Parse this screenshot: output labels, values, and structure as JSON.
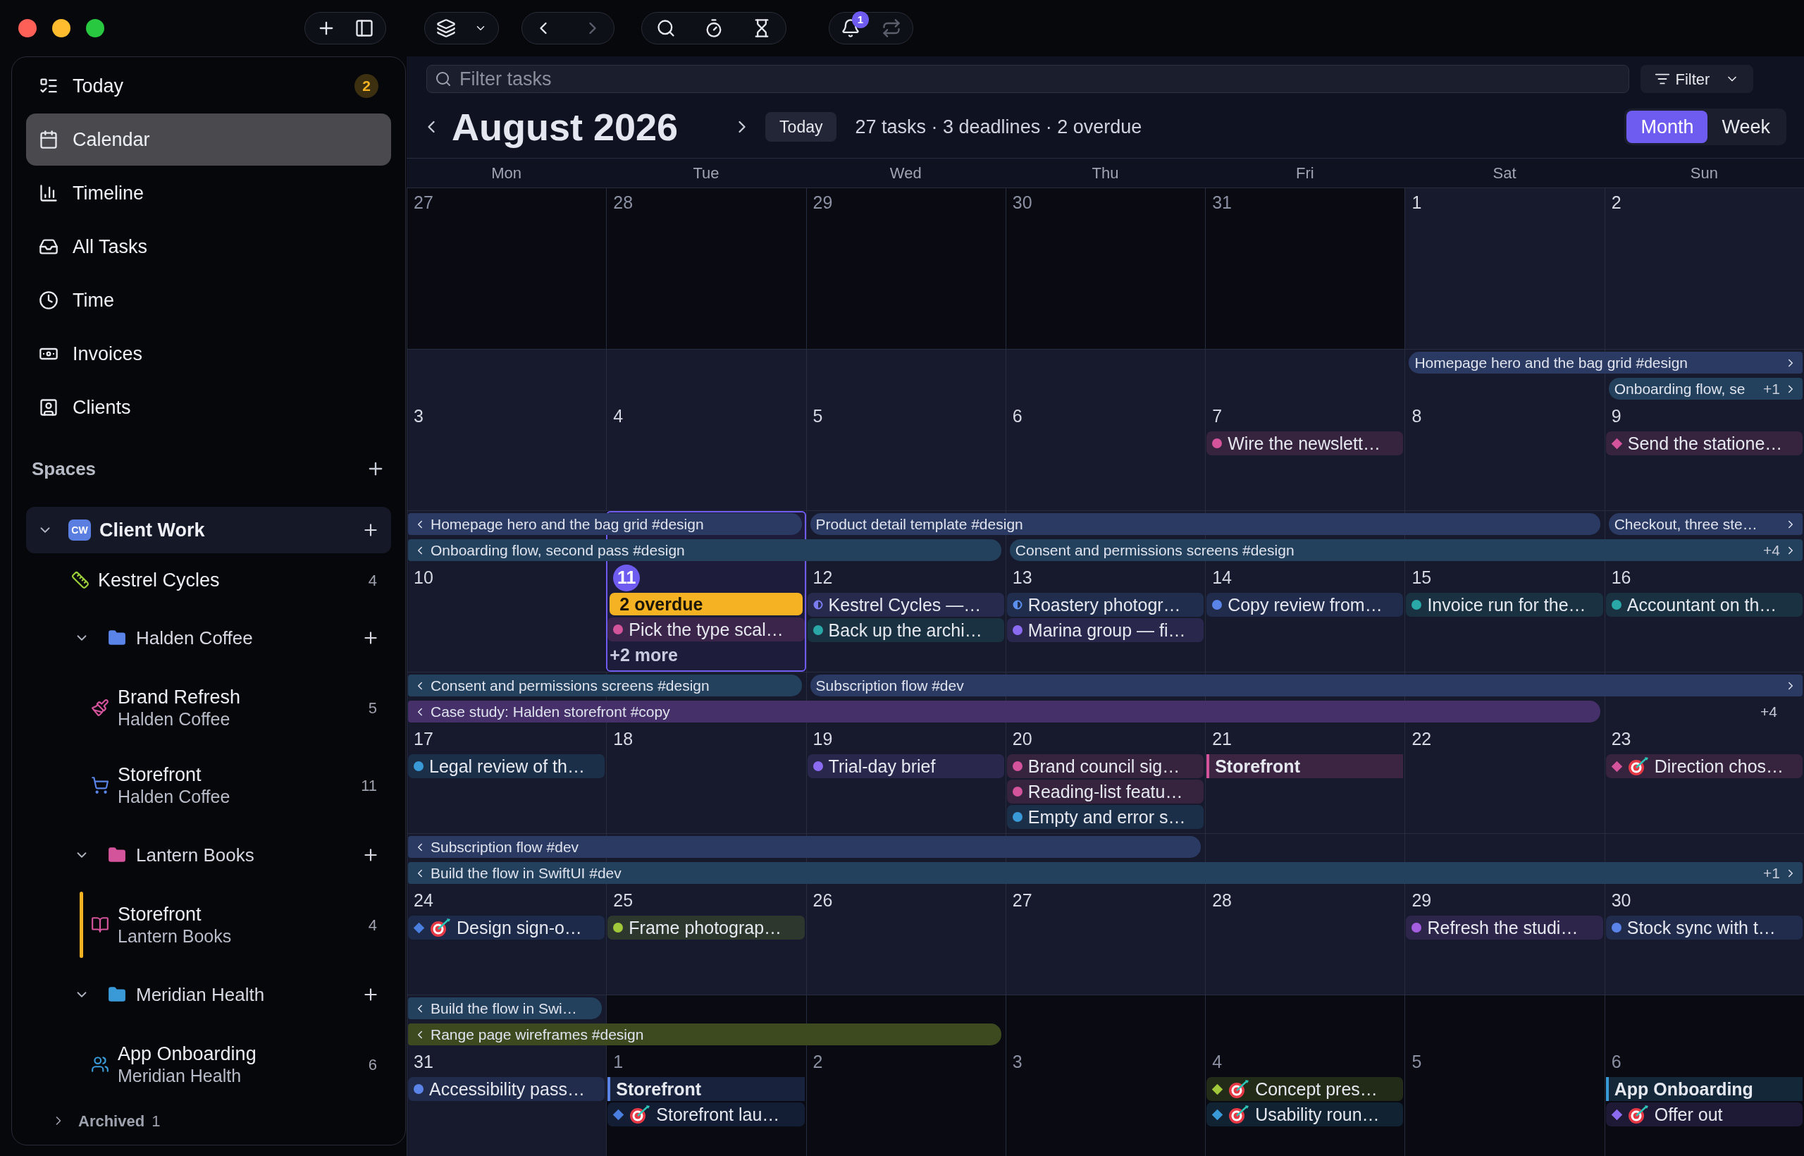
{
  "toolbar": {
    "notification_badge": "1",
    "forward_disabled": true,
    "sync_disabled": true
  },
  "sidebar": {
    "nav": [
      {
        "label": "Today",
        "badge": "2",
        "selected": false
      },
      {
        "label": "Calendar",
        "selected": true
      },
      {
        "label": "Timeline",
        "selected": false
      },
      {
        "label": "All Tasks",
        "selected": false
      },
      {
        "label": "Time",
        "selected": false
      },
      {
        "label": "Invoices",
        "selected": false
      },
      {
        "label": "Clients",
        "selected": false
      }
    ],
    "spaces_title": "Spaces",
    "spaces": [
      {
        "label": "Client Work",
        "initials": "CW",
        "expanded": true,
        "children": [
          {
            "kind": "project",
            "label": "Kestrel Cycles",
            "count": "4",
            "color": "#9ccf3a",
            "marked": false
          },
          {
            "kind": "folder",
            "label": "Halden Coffee",
            "color": "#5b84e8",
            "expanded": true,
            "children": [
              {
                "kind": "project",
                "label": "Brand Refresh",
                "subtitle": "Halden Coffee",
                "count": "5",
                "color": "#d4549c",
                "marked": false
              },
              {
                "kind": "project",
                "label": "Storefront",
                "subtitle": "Halden Coffee",
                "count": "11",
                "color": "#5b84e8",
                "marked": false
              }
            ]
          },
          {
            "kind": "folder",
            "label": "Lantern Books",
            "color": "#d4549c",
            "expanded": true,
            "children": [
              {
                "kind": "project",
                "label": "Storefront",
                "subtitle": "Lantern Books",
                "count": "4",
                "color": "#d4549c",
                "marked": true
              }
            ]
          },
          {
            "kind": "folder",
            "label": "Meridian Health",
            "color": "#3a9ad8",
            "expanded": true,
            "children": [
              {
                "kind": "project",
                "label": "App Onboarding",
                "subtitle": "Meridian Health",
                "count": "6",
                "color": "#3a9ad8",
                "marked": false
              }
            ]
          }
        ]
      }
    ],
    "archived": {
      "label": "Archived",
      "count": "1",
      "expanded": false
    }
  },
  "filter": {
    "placeholder": "Filter tasks",
    "button": "Filter"
  },
  "header": {
    "title": "August 2026",
    "today_button": "Today",
    "summary": "27 tasks · 3 deadlines · 2 overdue",
    "view_modes": [
      {
        "label": "Month",
        "selected": true
      },
      {
        "label": "Week",
        "selected": false
      }
    ]
  },
  "calendar": {
    "weekdays": [
      "Mon",
      "Tue",
      "Wed",
      "Thu",
      "Fri",
      "Sat",
      "Sun"
    ],
    "weeks": [
      {
        "days": [
          {
            "number": "27",
            "muted": true,
            "today": false
          },
          {
            "number": "28",
            "muted": true,
            "today": false
          },
          {
            "number": "29",
            "muted": true,
            "today": false
          },
          {
            "number": "30",
            "muted": true,
            "today": false
          },
          {
            "number": "31",
            "muted": true,
            "today": false
          },
          {
            "number": "1",
            "muted": false,
            "today": false
          },
          {
            "number": "2",
            "muted": false,
            "today": false
          }
        ]
      },
      {
        "lanes": [
          [
            {
              "kind": "empty"
            },
            {
              "kind": "empty"
            },
            {
              "kind": "empty"
            },
            {
              "kind": "empty"
            },
            {
              "kind": "empty"
            },
            {
              "kind": "bar",
              "label": "Homepage hero and the bag grid #design",
              "continues_left": false,
              "continues_right": true,
              "color": "#2b3a63"
            },
            {
              "kind": "span"
            }
          ],
          [
            {
              "kind": "empty"
            },
            {
              "kind": "empty"
            },
            {
              "kind": "empty"
            },
            {
              "kind": "empty"
            },
            {
              "kind": "empty"
            },
            {
              "kind": "empty"
            },
            {
              "kind": "bar",
              "label": "Onboarding flow, se",
              "continues_left": false,
              "continues_right": true,
              "more": "+1",
              "color": "#23405c"
            }
          ]
        ],
        "days": [
          {
            "number": "3",
            "muted": false,
            "today": false
          },
          {
            "number": "4",
            "muted": false,
            "today": false
          },
          {
            "number": "5",
            "muted": false,
            "today": false
          },
          {
            "number": "6",
            "muted": false,
            "today": false
          },
          {
            "number": "7",
            "muted": false,
            "today": false,
            "items": [
              {
                "kind": "task",
                "label": "Wire the newslett…",
                "color": "#d4549c"
              }
            ]
          },
          {
            "number": "8",
            "muted": false,
            "today": false
          },
          {
            "number": "9",
            "muted": false,
            "today": false,
            "items": [
              {
                "kind": "deadline",
                "label": "Send the statione…",
                "color": "#d4549c",
                "target": false
              }
            ]
          }
        ]
      },
      {
        "lanes": [
          [
            {
              "kind": "bar",
              "label": "Homepage hero and the bag grid #design",
              "continues_left": true,
              "continues_right": false,
              "color": "#2b3a63"
            },
            {
              "kind": "span"
            },
            {
              "kind": "bar",
              "label": "Product detail template #design",
              "continues_left": false,
              "continues_right": false,
              "color": "#2b3a63"
            },
            {
              "kind": "span"
            },
            {
              "kind": "span"
            },
            {
              "kind": "span"
            },
            {
              "kind": "bar",
              "label": "Checkout, three ste…",
              "continues_left": false,
              "continues_right": true,
              "color": "#2b3a63"
            }
          ],
          [
            {
              "kind": "bar",
              "label": "Onboarding flow, second pass #design",
              "continues_left": true,
              "continues_right": false,
              "color": "#23405c"
            },
            {
              "kind": "span"
            },
            {
              "kind": "span"
            },
            {
              "kind": "bar",
              "label": "Consent and permissions screens #design",
              "continues_left": false,
              "continues_right": true,
              "more": "+4",
              "color": "#23405c"
            },
            {
              "kind": "span"
            },
            {
              "kind": "span"
            },
            {
              "kind": "span"
            }
          ]
        ],
        "days": [
          {
            "number": "10",
            "muted": false,
            "today": false
          },
          {
            "number": "11",
            "muted": false,
            "today": true,
            "items": [
              {
                "kind": "overdue",
                "label": "2 overdue"
              },
              {
                "kind": "task",
                "label": "Pick the type scal…",
                "color": "#d4549c"
              },
              {
                "kind": "more",
                "label": "+2 more"
              }
            ]
          },
          {
            "number": "12",
            "muted": false,
            "today": false,
            "items": [
              {
                "kind": "progress",
                "label": "Kestrel Cycles —…",
                "color": "#7a7cf0"
              },
              {
                "kind": "task",
                "label": "Back up the archi…",
                "color": "#2aa8a8"
              }
            ]
          },
          {
            "number": "13",
            "muted": false,
            "today": false,
            "items": [
              {
                "kind": "progress",
                "label": "Roastery photogr…",
                "color": "#5b8ff0"
              },
              {
                "kind": "task",
                "label": "Marina group — fi…",
                "color": "#8b6cf0"
              }
            ]
          },
          {
            "number": "14",
            "muted": false,
            "today": false,
            "items": [
              {
                "kind": "task",
                "label": "Copy review from…",
                "color": "#5b84e8"
              }
            ]
          },
          {
            "number": "15",
            "muted": false,
            "today": false,
            "items": [
              {
                "kind": "task",
                "label": "Invoice run for the…",
                "color": "#2aa8a8"
              }
            ]
          },
          {
            "number": "16",
            "muted": false,
            "today": false,
            "items": [
              {
                "kind": "task",
                "label": "Accountant on th…",
                "color": "#2aa8a8"
              }
            ]
          }
        ]
      },
      {
        "lanes": [
          [
            {
              "kind": "bar",
              "label": "Consent and permissions screens #design",
              "continues_left": true,
              "continues_right": false,
              "color": "#23405c"
            },
            {
              "kind": "span"
            },
            {
              "kind": "bar",
              "label": "Subscription flow #dev",
              "continues_left": false,
              "continues_right": true,
              "color": "#2b3a63"
            },
            {
              "kind": "span"
            },
            {
              "kind": "span"
            },
            {
              "kind": "span"
            },
            {
              "kind": "span"
            }
          ],
          [
            {
              "kind": "bar",
              "label": "Case study: Halden storefront #copy",
              "continues_left": true,
              "continues_right": false,
              "color": "#45306a"
            },
            {
              "kind": "span"
            },
            {
              "kind": "span"
            },
            {
              "kind": "span"
            },
            {
              "kind": "span"
            },
            {
              "kind": "span"
            },
            {
              "kind": "more",
              "label": "+4"
            }
          ]
        ],
        "days": [
          {
            "number": "17",
            "muted": false,
            "today": false,
            "items": [
              {
                "kind": "task",
                "label": "Legal review of th…",
                "color": "#3a9ad8"
              }
            ]
          },
          {
            "number": "18",
            "muted": false,
            "today": false
          },
          {
            "number": "19",
            "muted": false,
            "today": false,
            "items": [
              {
                "kind": "task",
                "label": "Trial-day brief",
                "color": "#8b6cf0"
              }
            ]
          },
          {
            "number": "20",
            "muted": false,
            "today": false,
            "items": [
              {
                "kind": "task",
                "label": "Brand council sig…",
                "color": "#d4549c"
              },
              {
                "kind": "task",
                "label": "Reading-list featu…",
                "color": "#d4549c"
              },
              {
                "kind": "task",
                "label": "Empty and error s…",
                "color": "#3a9ad8"
              }
            ]
          },
          {
            "number": "21",
            "muted": false,
            "today": false,
            "items": [
              {
                "kind": "project",
                "label": "Storefront",
                "color": "#d4549c"
              }
            ]
          },
          {
            "number": "22",
            "muted": false,
            "today": false
          },
          {
            "number": "23",
            "muted": false,
            "today": false,
            "items": [
              {
                "kind": "deadline",
                "label": "Direction chos…",
                "color": "#d4549c",
                "target": true
              }
            ]
          }
        ]
      },
      {
        "lanes": [
          [
            {
              "kind": "bar",
              "label": "Subscription flow #dev",
              "continues_left": true,
              "continues_right": false,
              "color": "#2b3a63"
            },
            {
              "kind": "span"
            },
            {
              "kind": "span"
            },
            {
              "kind": "span"
            },
            {
              "kind": "empty"
            },
            {
              "kind": "empty"
            },
            {
              "kind": "empty"
            }
          ],
          [
            {
              "kind": "bar",
              "label": "Build the flow in SwiftUI #dev",
              "continues_left": true,
              "continues_right": true,
              "more": "+1",
              "color": "#23405c"
            },
            {
              "kind": "span"
            },
            {
              "kind": "span"
            },
            {
              "kind": "span"
            },
            {
              "kind": "span"
            },
            {
              "kind": "span"
            },
            {
              "kind": "span"
            }
          ]
        ],
        "days": [
          {
            "number": "24",
            "muted": false,
            "today": false,
            "items": [
              {
                "kind": "deadline",
                "label": "Design sign-o…",
                "color": "#4a7fe0",
                "target": true
              }
            ]
          },
          {
            "number": "25",
            "muted": false,
            "today": false,
            "items": [
              {
                "kind": "task",
                "label": "Frame photograp…",
                "color": "#a0c83a"
              }
            ]
          },
          {
            "number": "26",
            "muted": false,
            "today": false
          },
          {
            "number": "27",
            "muted": false,
            "today": false
          },
          {
            "number": "28",
            "muted": false,
            "today": false
          },
          {
            "number": "29",
            "muted": false,
            "today": false,
            "items": [
              {
                "kind": "task",
                "label": "Refresh the studi…",
                "color": "#a65ee0"
              }
            ]
          },
          {
            "number": "30",
            "muted": false,
            "today": false,
            "items": [
              {
                "kind": "task",
                "label": "Stock sync with t…",
                "color": "#5b84e8"
              }
            ]
          }
        ]
      },
      {
        "lanes": [
          [
            {
              "kind": "bar",
              "label": "Build the flow in Swi…",
              "continues_left": true,
              "continues_right": false,
              "color": "#23405c"
            },
            {
              "kind": "empty"
            },
            {
              "kind": "empty"
            },
            {
              "kind": "empty"
            },
            {
              "kind": "empty"
            },
            {
              "kind": "empty"
            },
            {
              "kind": "empty"
            }
          ],
          [
            {
              "kind": "bar",
              "label": "Range page wireframes #design",
              "continues_left": true,
              "continues_right": false,
              "color": "#3d4a1f"
            },
            {
              "kind": "span"
            },
            {
              "kind": "span"
            },
            {
              "kind": "empty"
            },
            {
              "kind": "empty"
            },
            {
              "kind": "empty"
            },
            {
              "kind": "empty"
            }
          ]
        ],
        "days": [
          {
            "number": "31",
            "muted": false,
            "today": false,
            "items": [
              {
                "kind": "task",
                "label": "Accessibility pass…",
                "color": "#5b84e8"
              }
            ]
          },
          {
            "number": "1",
            "muted": true,
            "today": false,
            "items": [
              {
                "kind": "project",
                "label": "Storefront",
                "color": "#5b84e8"
              },
              {
                "kind": "deadline",
                "label": "Storefront lau…",
                "color": "#4a7fe0",
                "target": true
              }
            ]
          },
          {
            "number": "2",
            "muted": true,
            "today": false
          },
          {
            "number": "3",
            "muted": true,
            "today": false
          },
          {
            "number": "4",
            "muted": true,
            "today": false,
            "items": [
              {
                "kind": "deadline",
                "label": "Concept pres…",
                "color": "#a0c83a",
                "target": true
              },
              {
                "kind": "deadline",
                "label": "Usability roun…",
                "color": "#3a9ad8",
                "target": true
              }
            ]
          },
          {
            "number": "5",
            "muted": true,
            "today": false
          },
          {
            "number": "6",
            "muted": true,
            "today": false,
            "items": [
              {
                "kind": "project",
                "label": "App Onboarding",
                "color": "#3a9ad8"
              },
              {
                "kind": "deadline",
                "label": "Offer out",
                "color": "#8b6cf0",
                "target": true
              }
            ]
          }
        ]
      }
    ]
  }
}
